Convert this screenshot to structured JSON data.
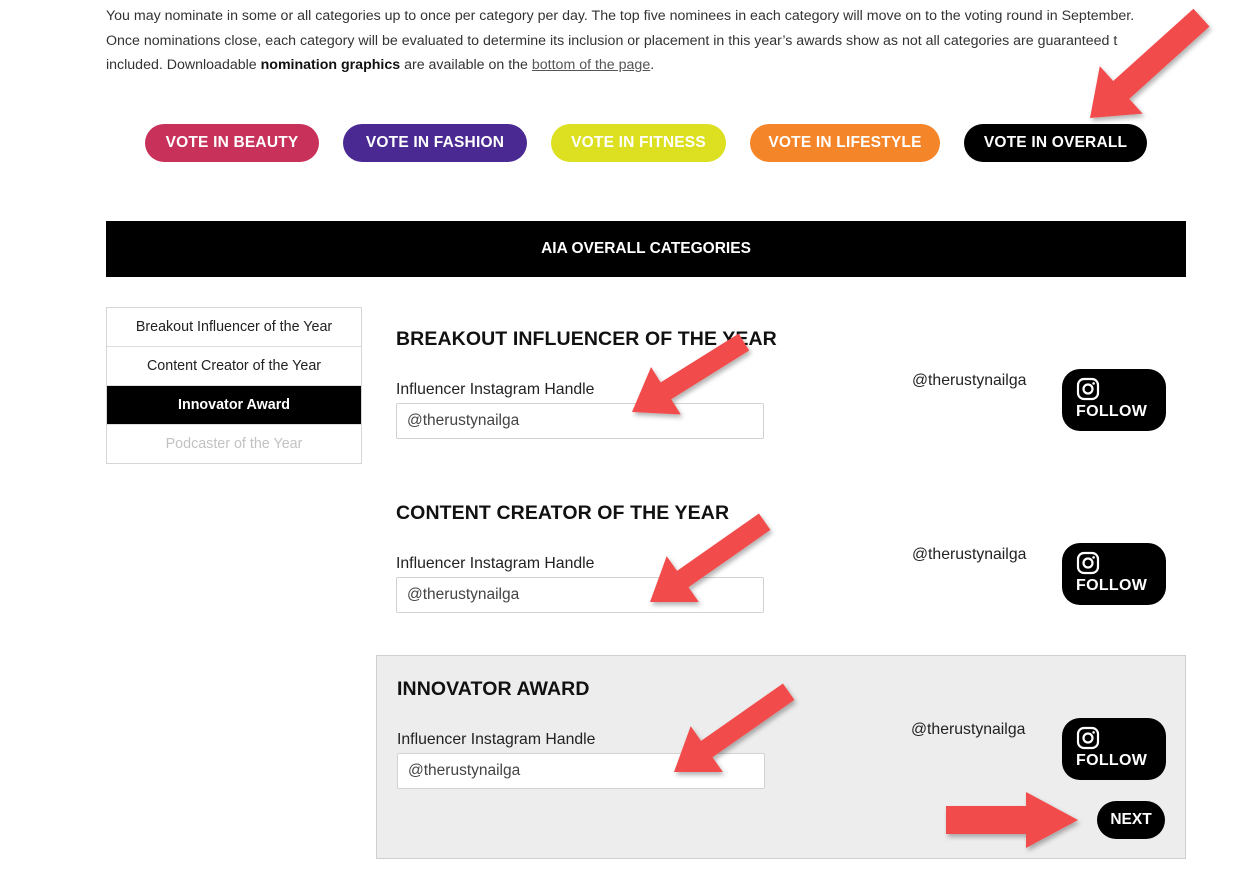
{
  "intro": {
    "line1": "You may nominate in some or all categories up to once per category per day. The top five nominees in each category will move on to the voting round in September.",
    "line2": "Once nominations close, each category will be evaluated to determine its inclusion or placement in this year’s awards show as not all categories are guaranteed t",
    "line3_pre": "included. Downloadable",
    "line3_bold": "nomination graphics",
    "line3_mid": "are available on the",
    "line3_link": "bottom of the page",
    "line3_end": "."
  },
  "vote_buttons": [
    {
      "label": "VOTE IN BEAUTY",
      "color": "#c8325a"
    },
    {
      "label": "VOTE IN FASHION",
      "color": "#4a2a92"
    },
    {
      "label": "VOTE IN FITNESS",
      "color": "#dde020"
    },
    {
      "label": "VOTE IN LIFESTYLE",
      "color": "#f58529"
    },
    {
      "label": "VOTE IN OVERALL",
      "color": "#000000"
    }
  ],
  "banner": {
    "title": "AIA OVERALL CATEGORIES"
  },
  "sidebar": {
    "items": [
      {
        "label": "Breakout Influencer of the Year",
        "state": "normal"
      },
      {
        "label": "Content Creator of the Year",
        "state": "normal"
      },
      {
        "label": "Innovator Award",
        "state": "active"
      },
      {
        "label": "Podcaster of the Year",
        "state": "disabled"
      }
    ]
  },
  "sections": [
    {
      "title": "BREAKOUT INFLUENCER OF THE YEAR",
      "field_label": "Influencer Instagram Handle",
      "input_value": "@therustynailga",
      "handle": "@therustynailga",
      "follow_label": "FOLLOW"
    },
    {
      "title": "CONTENT CREATOR OF THE YEAR",
      "field_label": "Influencer Instagram Handle",
      "input_value": "@therustynailga",
      "handle": "@therustynailga",
      "follow_label": "FOLLOW"
    },
    {
      "title": "INNOVATOR AWARD",
      "field_label": "Influencer Instagram Handle",
      "input_value": "@therustynailga",
      "handle": "@therustynailga",
      "follow_label": "FOLLOW",
      "next_label": "NEXT"
    }
  ],
  "colors": {
    "annotation_arrow": "#f24b4b",
    "active_tab": "#000000",
    "highlight_panel": "#ededed"
  },
  "icons": [
    "instagram-icon",
    "annotation-arrow"
  ]
}
